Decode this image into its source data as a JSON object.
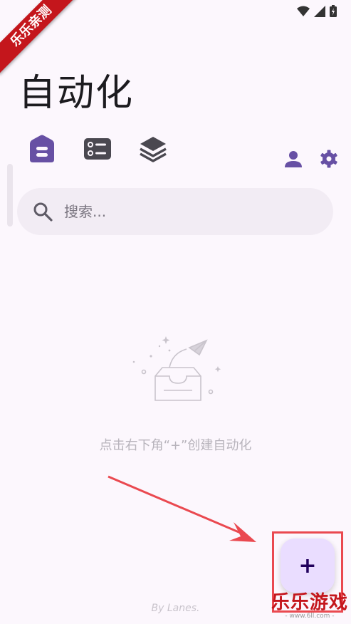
{
  "page": {
    "title": "自动化"
  },
  "watermark_ribbon": "乐乐亲测",
  "tabs": [
    {
      "name": "automation",
      "icon": "home-card-icon",
      "active": true
    },
    {
      "name": "list",
      "icon": "checklist-icon",
      "active": false
    },
    {
      "name": "layers",
      "icon": "layers-icon",
      "active": false
    }
  ],
  "actions": {
    "account_icon": "person-icon",
    "settings_icon": "gear-icon"
  },
  "search": {
    "placeholder": "搜索..."
  },
  "empty_state": {
    "message": "点击右下角“+”创建自动化",
    "icon": "empty-inbox-icon"
  },
  "fab": {
    "label": "+"
  },
  "footer": {
    "byline": "By Lanes."
  },
  "watermark_logo": {
    "main": "乐乐游戏",
    "sub": "- www.6ll.com -"
  },
  "colors": {
    "background": "#fcf7fd",
    "accent": "#6750a4",
    "fab_bg": "#eaddff",
    "annotation": "#ea4950"
  }
}
